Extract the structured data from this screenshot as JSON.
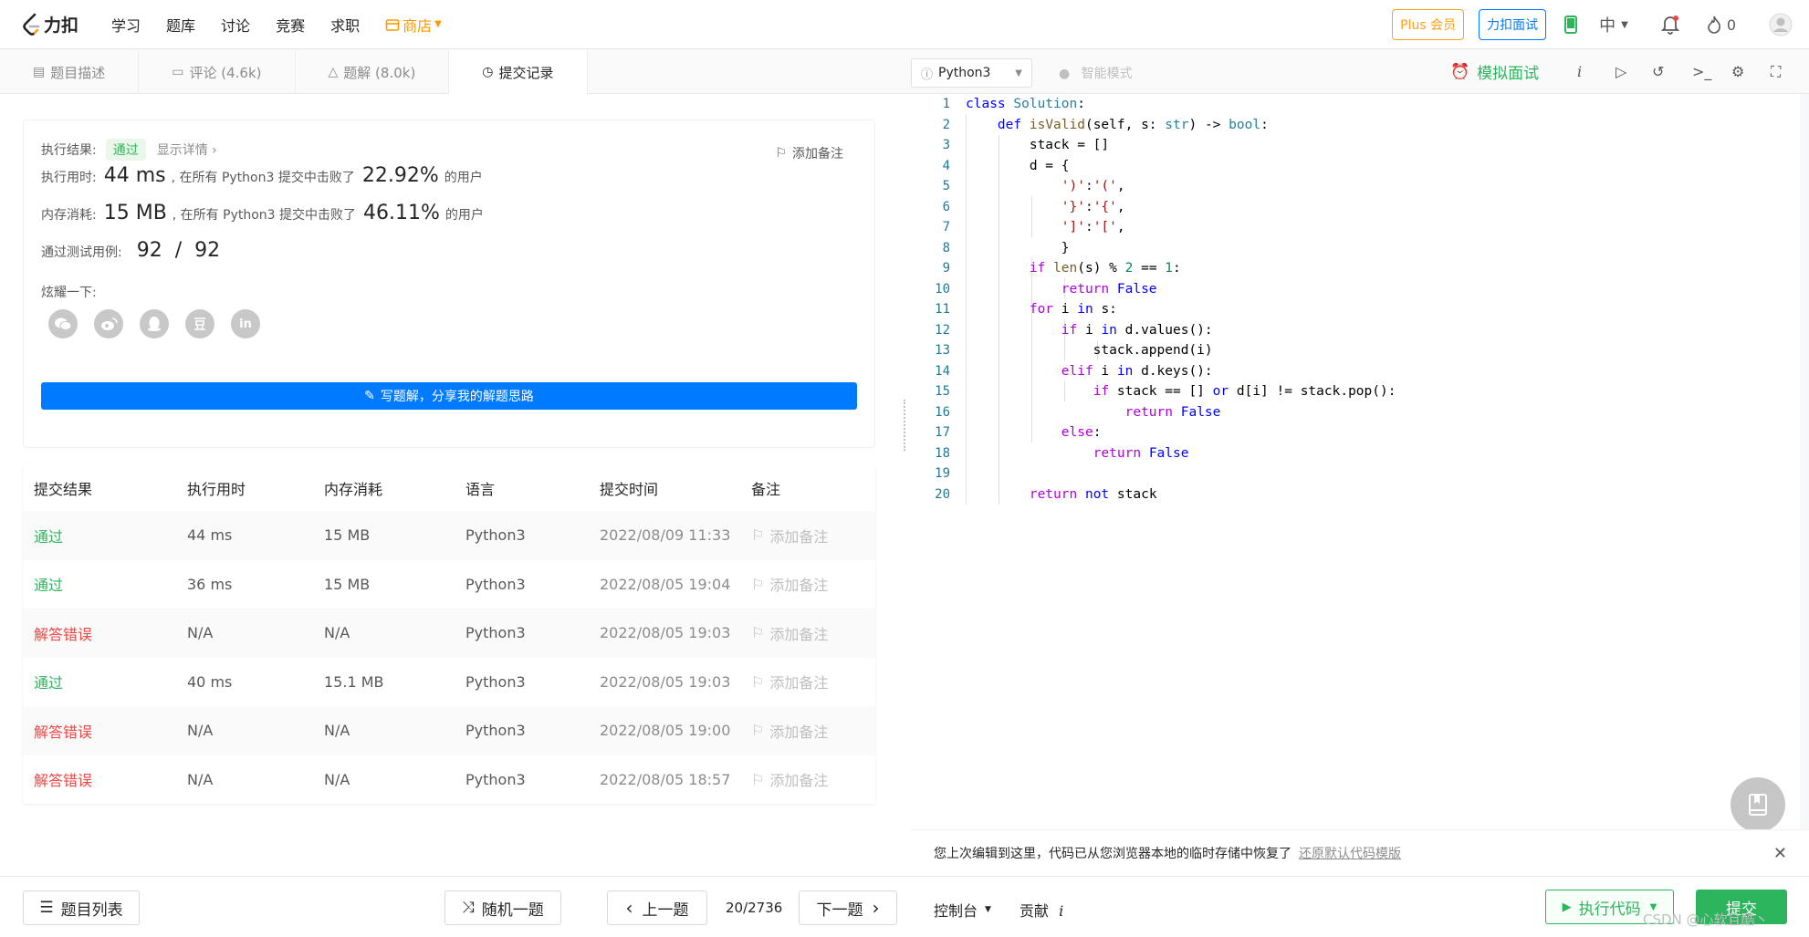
{
  "nav": {
    "brand": "力扣",
    "items": [
      "学习",
      "题库",
      "讨论",
      "竞赛",
      "求职"
    ],
    "shop": "商店",
    "plus": "Plus 会员",
    "interview": "力扣面试",
    "lang": "中",
    "points": "0"
  },
  "left_tabs": [
    {
      "label": "题目描述"
    },
    {
      "label": "评论 (4.6k)"
    },
    {
      "label": "题解 (8.0k)"
    },
    {
      "label": "提交记录"
    }
  ],
  "result": {
    "label": "执行结果:",
    "status": "通过",
    "detail": "显示详情 ›",
    "add_note": "添加备注",
    "time_label": "执行用时:",
    "time_value": "44 ms",
    "time_mid": ", 在所有 Python3 提交中击败了",
    "time_pct": "22.92%",
    "time_tail": "的用户",
    "mem_label": "内存消耗:",
    "mem_value": "15 MB",
    "mem_mid": ", 在所有 Python3 提交中击败了",
    "mem_pct": "46.11%",
    "mem_tail": "的用户",
    "tests_label": "通过测试用例:",
    "tests_value": "92  /  92",
    "share_label": "炫耀一下:",
    "share_in": "in",
    "write_btn": "写题解，分享我的解题思路"
  },
  "table": {
    "headers": [
      "提交结果",
      "执行用时",
      "内存消耗",
      "语言",
      "提交时间",
      "备注"
    ],
    "rows": [
      {
        "status": "通过",
        "time": "44 ms",
        "mem": "15 MB",
        "lang": "Python3",
        "date": "2022/08/09 11:33",
        "note": "添加备注"
      },
      {
        "status": "通过",
        "time": "36 ms",
        "mem": "15 MB",
        "lang": "Python3",
        "date": "2022/08/05 19:04",
        "note": "添加备注"
      },
      {
        "status": "解答错误",
        "time": "N/A",
        "mem": "N/A",
        "lang": "Python3",
        "date": "2022/08/05 19:03",
        "note": "添加备注"
      },
      {
        "status": "通过",
        "time": "40 ms",
        "mem": "15.1 MB",
        "lang": "Python3",
        "date": "2022/08/05 19:03",
        "note": "添加备注"
      },
      {
        "status": "解答错误",
        "time": "N/A",
        "mem": "N/A",
        "lang": "Python3",
        "date": "2022/08/05 19:00",
        "note": "添加备注"
      },
      {
        "status": "解答错误",
        "time": "N/A",
        "mem": "N/A",
        "lang": "Python3",
        "date": "2022/08/05 18:57",
        "note": "添加备注"
      }
    ]
  },
  "editor": {
    "language": "Python3",
    "smart_mode": "智能模式",
    "mock": "模拟面试",
    "info": "i",
    "lines": [
      "1",
      "2",
      "3",
      "4",
      "5",
      "6",
      "7",
      "8",
      "9",
      "10",
      "11",
      "12",
      "13",
      "14",
      "15",
      "16",
      "17",
      "18",
      "19",
      "20"
    ]
  },
  "restore": {
    "text": "您上次编辑到这里，代码已从您浏览器本地的临时存储中恢复了",
    "link": "还原默认代码模版"
  },
  "bottom": {
    "problem_list": "题目列表",
    "random": "随机一题",
    "prev": "上一题",
    "progress": "20/2736",
    "next": "下一题",
    "console": "控制台",
    "contribute": "贡献",
    "contribute_i": "i",
    "run": "执行代码",
    "submit": "提交"
  },
  "watermark": "CSDN @心软且酷丶"
}
